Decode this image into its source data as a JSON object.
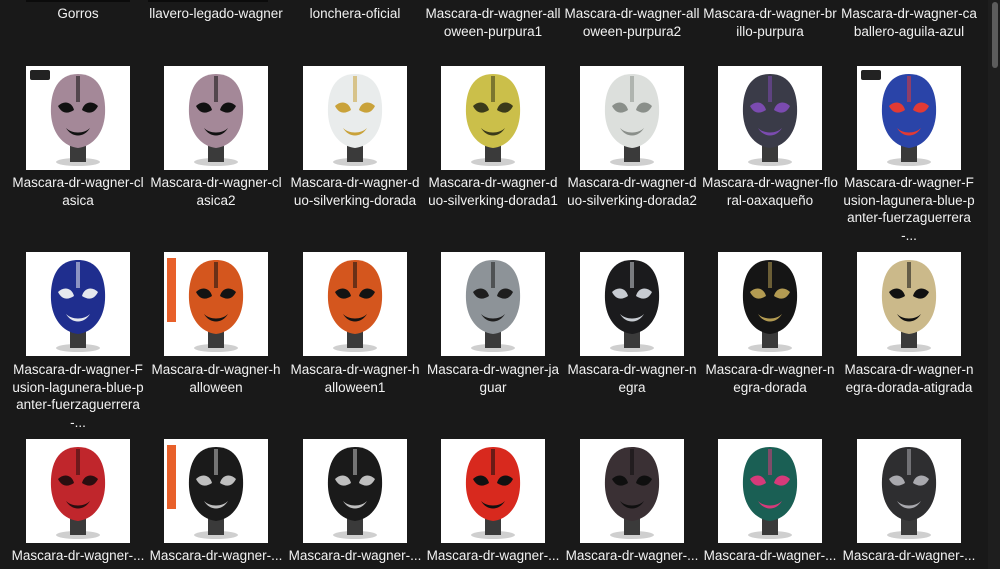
{
  "rows": [
    {
      "items": [
        {
          "label": "Gorros",
          "thumb": false
        },
        {
          "label": "llavero-legado-wagner",
          "thumb": false
        },
        {
          "label": "lonchera-oficial",
          "thumb": false
        },
        {
          "label": "Mascara-dr-wagner-alloween-purpura1",
          "thumb": false
        },
        {
          "label": "Mascara-dr-wagner-alloween-purpura2",
          "thumb": false
        },
        {
          "label": "Mascara-dr-wagner-brillo-purpura",
          "thumb": false
        },
        {
          "label": "Mascara-dr-wagner-caballero-aguila-azul",
          "thumb": false
        }
      ]
    },
    {
      "items": [
        {
          "label": "Mascara-dr-wagner-clasica",
          "thumb": true,
          "mask": "#a48898",
          "accent": "#111111",
          "tag": "logo"
        },
        {
          "label": "Mascara-dr-wagner-clasica2",
          "thumb": true,
          "mask": "#a48898",
          "accent": "#111111",
          "tag": ""
        },
        {
          "label": "Mascara-dr-wagner-duo-silverking-dorada",
          "thumb": true,
          "mask": "#e9ecec",
          "accent": "#c9a23a",
          "tag": ""
        },
        {
          "label": "Mascara-dr-wagner-duo-silverking-dorada1",
          "thumb": true,
          "mask": "#cbbf4a",
          "accent": "#3a3a1a",
          "tag": ""
        },
        {
          "label": "Mascara-dr-wagner-duo-silverking-dorada2",
          "thumb": true,
          "mask": "#dcdfdc",
          "accent": "#8a8f8a",
          "tag": ""
        },
        {
          "label": "Mascara-dr-wagner-floral-oaxaqueño",
          "thumb": true,
          "mask": "#3a3b48",
          "accent": "#7b4bb0",
          "tag": ""
        },
        {
          "label": "Mascara-dr-wagner-Fusion-lagunera-blue-panter-fuerzaguerrera-...",
          "thumb": true,
          "mask": "#2a44a8",
          "accent": "#e23a34",
          "tag": "logo"
        }
      ]
    },
    {
      "items": [
        {
          "label": "Mascara-dr-wagner-Fusion-lagunera-blue-panter-fuerzaguerrera-...",
          "thumb": true,
          "mask": "#1f2e8e",
          "accent": "#e5e8ee",
          "tag": ""
        },
        {
          "label": "Mascara-dr-wagner-halloween",
          "thumb": true,
          "mask": "#d4561e",
          "accent": "#131313",
          "tag": "orange"
        },
        {
          "label": "Mascara-dr-wagner-halloween1",
          "thumb": true,
          "mask": "#d4561e",
          "accent": "#131313",
          "tag": ""
        },
        {
          "label": "Mascara-dr-wagner-jaguar",
          "thumb": true,
          "mask": "#8d9398",
          "accent": "#1e1e1e",
          "tag": ""
        },
        {
          "label": "Mascara-dr-wagner-negra",
          "thumb": true,
          "mask": "#1b1b1d",
          "accent": "#c8ccd2",
          "tag": ""
        },
        {
          "label": "Mascara-dr-wagner-negra-dorada",
          "thumb": true,
          "mask": "#151515",
          "accent": "#b39b52",
          "tag": ""
        },
        {
          "label": "Mascara-dr-wagner-negra-dorada-atigrada",
          "thumb": true,
          "mask": "#cbb98a",
          "accent": "#111111",
          "tag": ""
        }
      ]
    },
    {
      "items": [
        {
          "label": "Mascara-dr-wagner-...",
          "thumb": true,
          "mask": "#c0262c",
          "accent": "#2a0e10",
          "tag": ""
        },
        {
          "label": "Mascara-dr-wagner-...",
          "thumb": true,
          "mask": "#1a1a1a",
          "accent": "#bfbfbf",
          "tag": "orange"
        },
        {
          "label": "Mascara-dr-wagner-...",
          "thumb": true,
          "mask": "#1a1a1a",
          "accent": "#bfbfbf",
          "tag": ""
        },
        {
          "label": "Mascara-dr-wagner-...",
          "thumb": true,
          "mask": "#d8291e",
          "accent": "#111111",
          "tag": ""
        },
        {
          "label": "Mascara-dr-wagner-...",
          "thumb": true,
          "mask": "#3a3034",
          "accent": "#0f0f0f",
          "tag": ""
        },
        {
          "label": "Mascara-dr-wagner-...",
          "thumb": true,
          "mask": "#1a5f54",
          "accent": "#d63a7a",
          "tag": ""
        },
        {
          "label": "Mascara-dr-wagner-...",
          "thumb": true,
          "mask": "#2e2e30",
          "accent": "#a9a9ae",
          "tag": ""
        }
      ]
    }
  ]
}
